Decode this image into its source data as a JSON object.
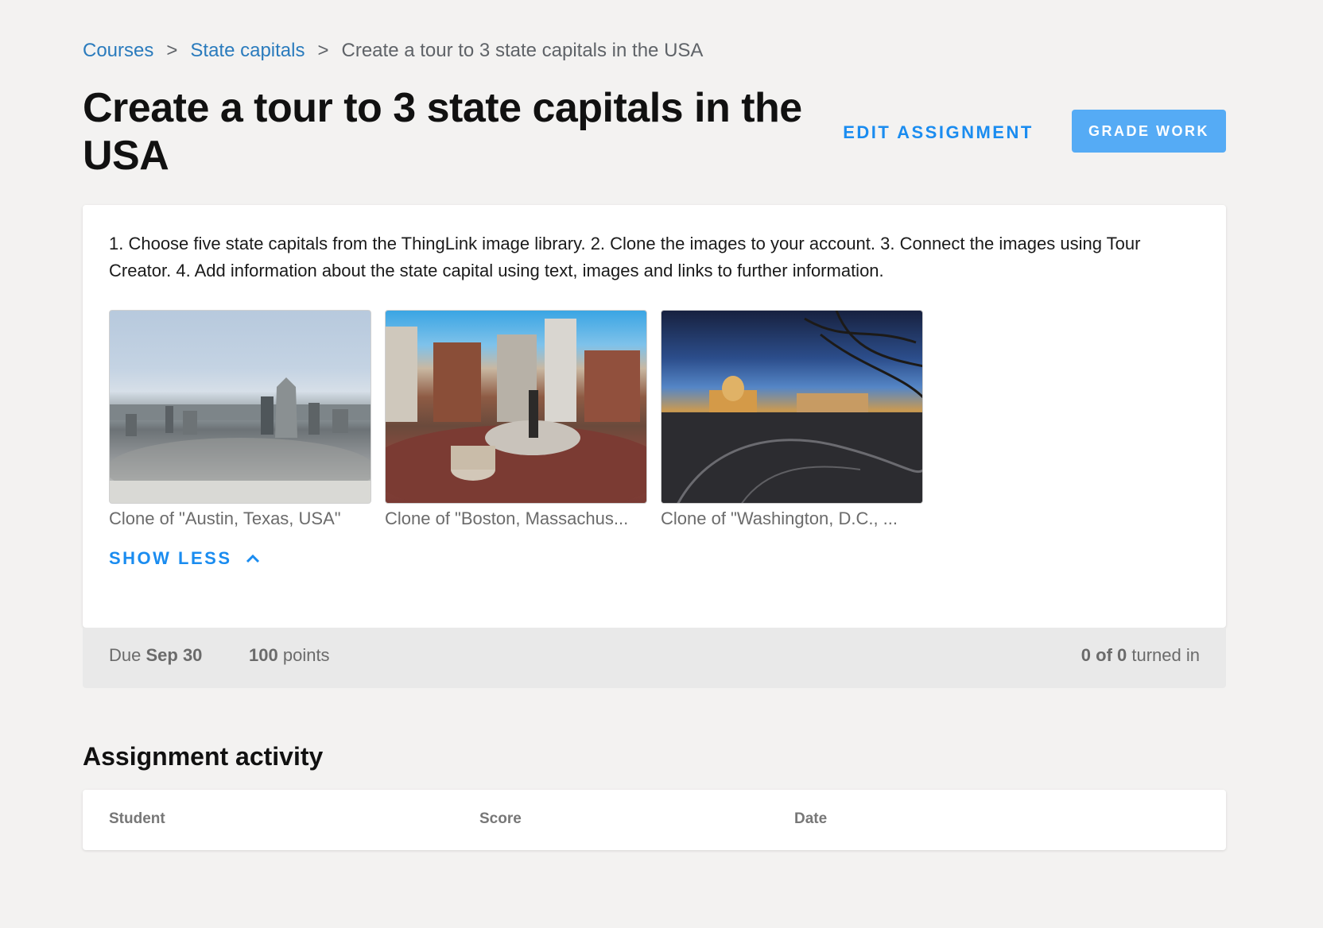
{
  "breadcrumb": {
    "items": [
      "Courses",
      "State capitals"
    ],
    "separator": ">",
    "current": "Create a tour to 3 state capitals in the USA"
  },
  "header": {
    "title": "Create a tour to 3 state capitals in the USA",
    "edit_label": "EDIT ASSIGNMENT",
    "grade_label": "GRADE WORK"
  },
  "assignment": {
    "description": "1. Choose five state capitals from the ThingLink image library. 2. Clone the images to your account. 3. Connect the images using Tour Creator. 4. Add information about the state capital using text, images and links to further information.",
    "thumbnails": [
      {
        "caption": "Clone of \"Austin, Texas, USA\""
      },
      {
        "caption": "Clone of \"Boston, Massachus..."
      },
      {
        "caption": "Clone of \"Washington, D.C., ..."
      }
    ],
    "show_less_label": "SHOW LESS"
  },
  "meta": {
    "due_prefix": "Due",
    "due_date": "Sep 30",
    "points_value": "100",
    "points_suffix": "points",
    "turned_in_count": "0 of 0",
    "turned_in_suffix": "turned in"
  },
  "activity": {
    "title": "Assignment activity",
    "columns": [
      "Student",
      "Score",
      "Date"
    ]
  },
  "colors": {
    "link": "#2a7bbd",
    "accent": "#1a8cf0",
    "primary_button": "#55abf5",
    "page_background": "#f3f2f1"
  }
}
